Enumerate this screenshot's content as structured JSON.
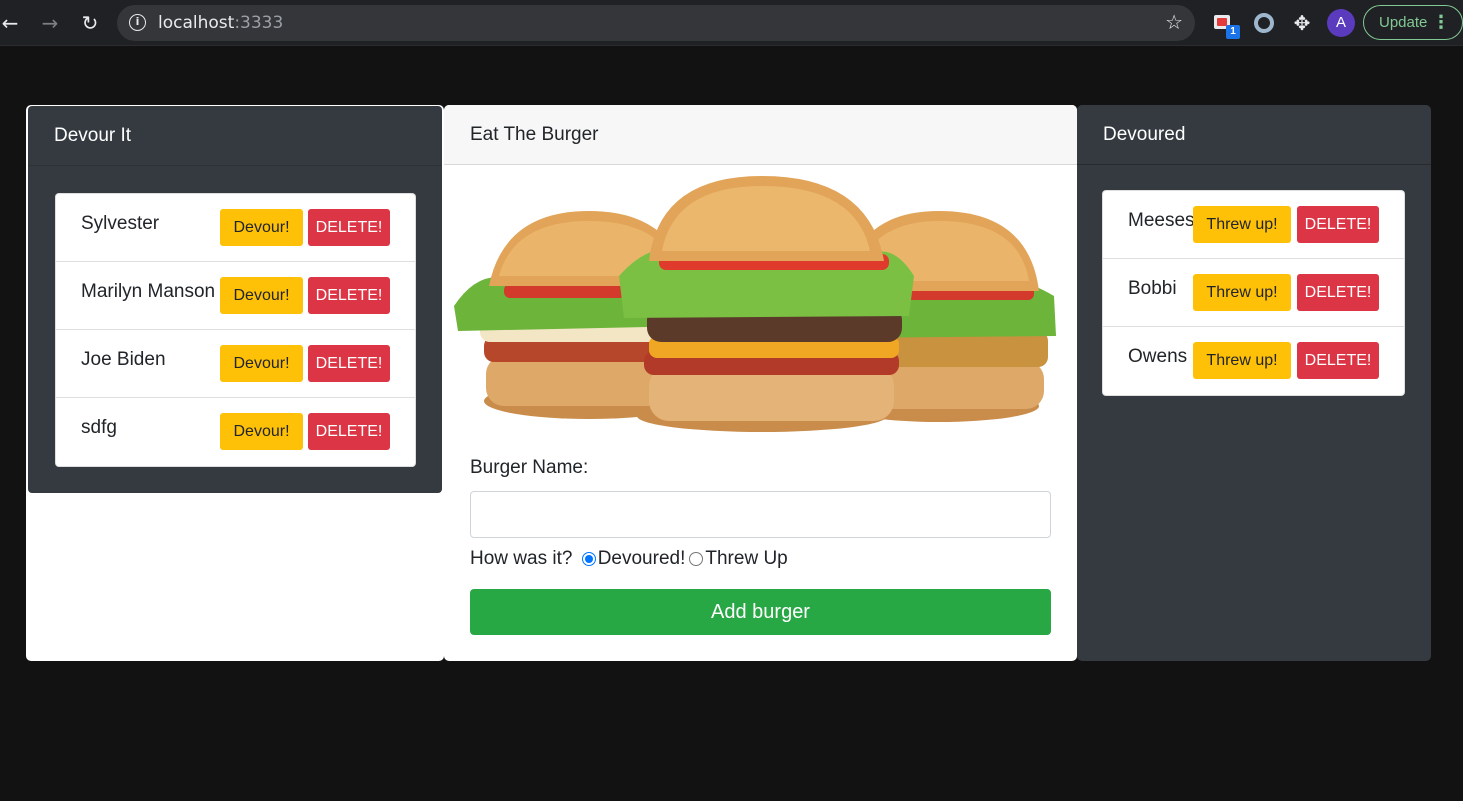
{
  "browser": {
    "url_host": "localhost",
    "url_port": ":3333",
    "extension_badge": "1",
    "profile_initial": "A",
    "update_label": "Update"
  },
  "devour_panel": {
    "title": "Devour It",
    "items": [
      {
        "name": "Sylvester",
        "devour_label": "Devour!",
        "delete_label": "DELETE!"
      },
      {
        "name": "Marilyn Manson",
        "devour_label": "Devour!",
        "delete_label": "DELETE!"
      },
      {
        "name": "Joe Biden",
        "devour_label": "Devour!",
        "delete_label": "DELETE!"
      },
      {
        "name": "sdfg",
        "devour_label": "Devour!",
        "delete_label": "DELETE!"
      }
    ]
  },
  "eat_panel": {
    "title": "Eat The Burger",
    "image": "burger-image",
    "form": {
      "name_label": "Burger Name:",
      "name_value": "",
      "question": "How was it?",
      "options": [
        "Devoured!",
        "Threw Up"
      ],
      "selected": "Devoured!",
      "submit_label": "Add burger"
    }
  },
  "devoured_panel": {
    "title": "Devoured",
    "items": [
      {
        "name": "Meeses",
        "threw_label": "Threw up!",
        "delete_label": "DELETE!"
      },
      {
        "name": "Bobbi",
        "threw_label": "Threw up!",
        "delete_label": "DELETE!"
      },
      {
        "name": "Owens",
        "threw_label": "Threw up!",
        "delete_label": "DELETE!"
      }
    ]
  },
  "colors": {
    "warning": "#ffc107",
    "danger": "#dc3545",
    "success": "#28a745",
    "dark": "#343a40"
  }
}
